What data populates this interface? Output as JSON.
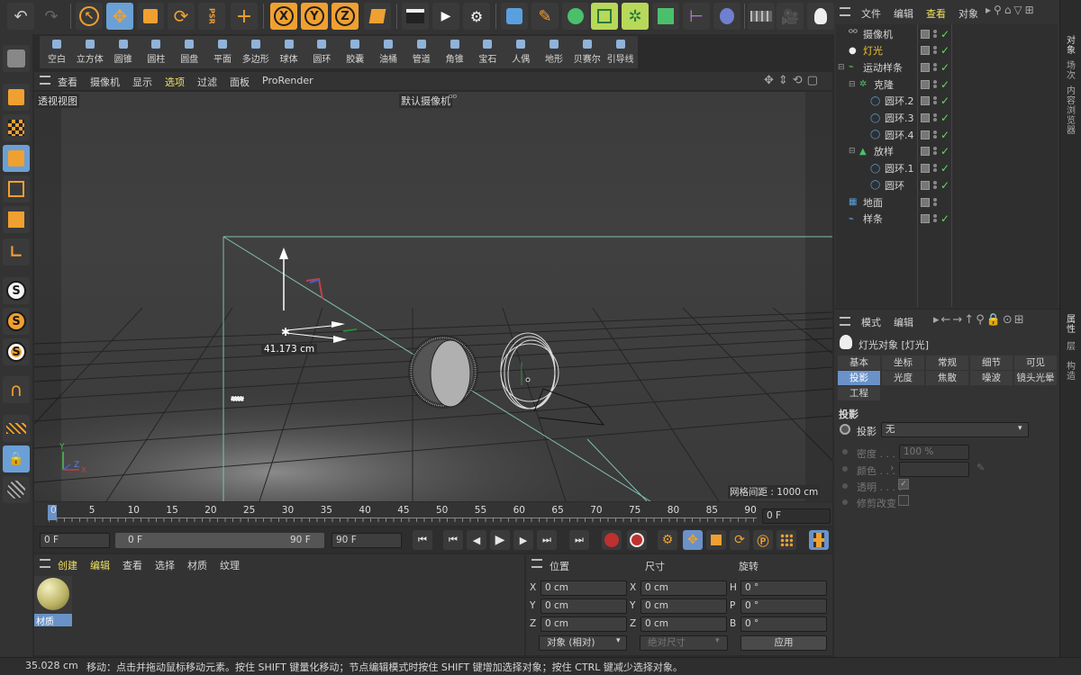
{
  "top_toolbar": {
    "psr_label": "PSR",
    "x_label": "X",
    "y_label": "Y",
    "z_label": "Z"
  },
  "primitives": [
    "空白",
    "立方体",
    "圆锥",
    "圆柱",
    "圆盘",
    "平面",
    "多边形",
    "球体",
    "圆环",
    "胶囊",
    "油桶",
    "管道",
    "角锥",
    "宝石",
    "人偶",
    "地形",
    "贝赛尔",
    "引导线"
  ],
  "viewport": {
    "menu": [
      "查看",
      "摄像机",
      "显示",
      "选项",
      "过滤",
      "面板",
      "ProRender"
    ],
    "active_menu_index": 3,
    "view_label": "透视视图",
    "camera_label": "默认摄像机",
    "distance_label": "41.173 cm",
    "grid_spacing": "网格间距 : 1000 cm",
    "axis_y": "Y",
    "axis_z": "Z",
    "axis_x": "X"
  },
  "timeline": {
    "ticks": [
      "0",
      "5",
      "10",
      "15",
      "20",
      "25",
      "30",
      "35",
      "40",
      "45",
      "50",
      "55",
      "60",
      "65",
      "70",
      "75",
      "80",
      "85",
      "90"
    ],
    "current_frame": "0 F"
  },
  "playback": {
    "start": "0 F",
    "range_start": "0 F",
    "range_end": "90 F",
    "end": "90 F"
  },
  "materials": {
    "menu": [
      "创建",
      "编辑",
      "查看",
      "选择",
      "材质",
      "纹理"
    ],
    "item_label": "材质"
  },
  "coords": {
    "position_header": "位置",
    "size_header": "尺寸",
    "rotation_header": "旋转",
    "rows": [
      {
        "axis": "X",
        "pos": "0 cm",
        "size_axis": "X",
        "size": "0 cm",
        "rot_axis": "H",
        "rot": "0 °"
      },
      {
        "axis": "Y",
        "pos": "0 cm",
        "size_axis": "Y",
        "size": "0 cm",
        "rot_axis": "P",
        "rot": "0 °"
      },
      {
        "axis": "Z",
        "pos": "0 cm",
        "size_axis": "Z",
        "size": "0 cm",
        "rot_axis": "B",
        "rot": "0 °"
      }
    ],
    "mode": "对象 (相对)",
    "size_mode": "绝对尺寸",
    "apply": "应用"
  },
  "status": {
    "value": "35.028 cm",
    "message": "移动：点击并拖动鼠标移动元素。按住 SHIFT 键量化移动；节点编辑模式时按住 SHIFT 键增加选择对象；按住 CTRL 键减少选择对象。"
  },
  "object_manager": {
    "menu": [
      "文件",
      "编辑",
      "查看",
      "对象"
    ],
    "active_menu_index": 2,
    "objects": [
      {
        "name": "摄像机",
        "indent": 0,
        "highlight": false
      },
      {
        "name": "灯光",
        "indent": 0,
        "highlight": true
      },
      {
        "name": "运动样条",
        "indent": 0,
        "highlight": false
      },
      {
        "name": "克隆",
        "indent": 1,
        "highlight": false
      },
      {
        "name": "圆环.2",
        "indent": 2,
        "highlight": false
      },
      {
        "name": "圆环.3",
        "indent": 2,
        "highlight": false
      },
      {
        "name": "圆环.4",
        "indent": 2,
        "highlight": false
      },
      {
        "name": "放样",
        "indent": 1,
        "highlight": false
      },
      {
        "name": "圆环.1",
        "indent": 2,
        "highlight": false
      },
      {
        "name": "圆环",
        "indent": 2,
        "highlight": false
      },
      {
        "name": "地面",
        "indent": 0,
        "highlight": false
      },
      {
        "name": "样条",
        "indent": 0,
        "highlight": false
      }
    ]
  },
  "attributes": {
    "menu": [
      "模式",
      "编辑"
    ],
    "title": "灯光对象 [灯光]",
    "tabs_row1": [
      "基本",
      "坐标",
      "常规",
      "细节",
      "可见"
    ],
    "tabs_row2": [
      "投影",
      "光度",
      "焦散",
      "噪波",
      "镜头光晕"
    ],
    "tabs_row3": [
      "工程"
    ],
    "active_tab": "投影",
    "section": "投影",
    "shadow_label": "投影",
    "shadow_value": "无",
    "density_label": "密度 . . . .",
    "density_value": "100 %",
    "color_label": "颜色 . . . .",
    "transparency_label": "透明 . . . .",
    "clip_label": "修剪改变"
  },
  "right_tabs": {
    "top": [
      "对象",
      "场次",
      "内容浏览器"
    ],
    "bottom": [
      "属性",
      "层",
      "构造"
    ]
  }
}
